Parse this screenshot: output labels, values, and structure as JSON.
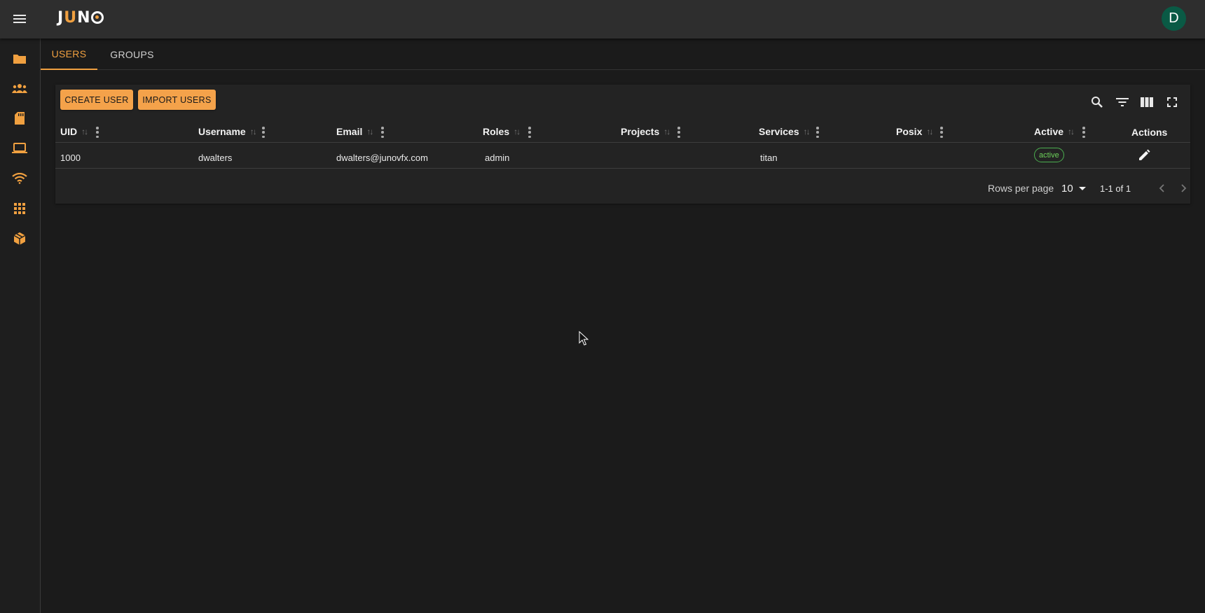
{
  "app": {
    "logo_text_j": "J",
    "logo_text_u": "U",
    "logo_text_n": "N",
    "user_initial": "D"
  },
  "tabs": [
    {
      "label": "USERS",
      "active": true
    },
    {
      "label": "GROUPS",
      "active": false
    }
  ],
  "sidebar": {
    "items": [
      {
        "icon": "folder-icon"
      },
      {
        "icon": "people-icon"
      },
      {
        "icon": "sd-card-icon"
      },
      {
        "icon": "laptop-icon"
      },
      {
        "icon": "wifi-icon"
      },
      {
        "icon": "apps-grid-icon"
      },
      {
        "icon": "cube-icon"
      }
    ]
  },
  "toolbar": {
    "create_label": "CREATE USER",
    "import_label": "IMPORT USERS",
    "icons": [
      "search-icon",
      "filter-icon",
      "columns-icon",
      "fullscreen-icon"
    ]
  },
  "table": {
    "columns": [
      "UID",
      "Username",
      "Email",
      "Roles",
      "Projects",
      "Services",
      "Posix",
      "Active",
      "Actions"
    ],
    "rows": [
      {
        "uid": "1000",
        "username": "dwalters",
        "email": "dwalters@junovfx.com",
        "roles": "admin",
        "projects": "",
        "services": "titan",
        "posix": "",
        "active": "active"
      }
    ]
  },
  "pagination": {
    "rows_per_page_label": "Rows per page",
    "rows_per_page_value": "10",
    "range": "1-1 of 1"
  },
  "colors": {
    "accent": "#f0a040",
    "button": "#f4a24a",
    "avatar": "#0a5a45",
    "active_badge": "#6ccf5a"
  }
}
